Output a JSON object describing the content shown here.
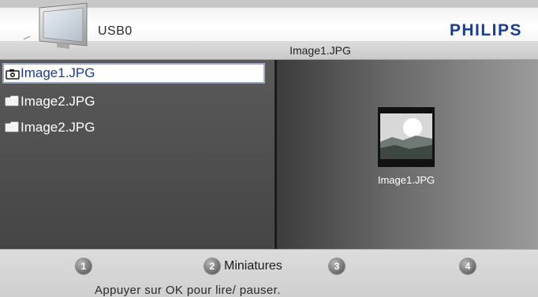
{
  "header": {
    "source": "USB0",
    "brand": "PHILIPS",
    "tv_icon": "tv-icon"
  },
  "file_bar": {
    "title": "Image1.JPG"
  },
  "files": [
    {
      "label": "Image1.JPG",
      "icon": "camera-icon",
      "selected": true
    },
    {
      "label": "Image2.JPG",
      "icon": "folder-icon",
      "selected": false
    },
    {
      "label": "Image2.JPG",
      "icon": "folder-icon",
      "selected": false
    }
  ],
  "preview": {
    "caption": "Image1.JPG",
    "thumb_icon": "landscape-thumbnail-icon"
  },
  "footer": {
    "keys": [
      {
        "number": "1",
        "label": ""
      },
      {
        "number": "2",
        "label": "Miniatures"
      },
      {
        "number": "3",
        "label": ""
      },
      {
        "number": "4",
        "label": ""
      }
    ],
    "hint": "Appuyer sur OK pour lire/ pauser."
  },
  "colors": {
    "brand": "#1a3f92",
    "selection_text": "#1f3c8c",
    "list_bg": "#4f4f4f"
  }
}
